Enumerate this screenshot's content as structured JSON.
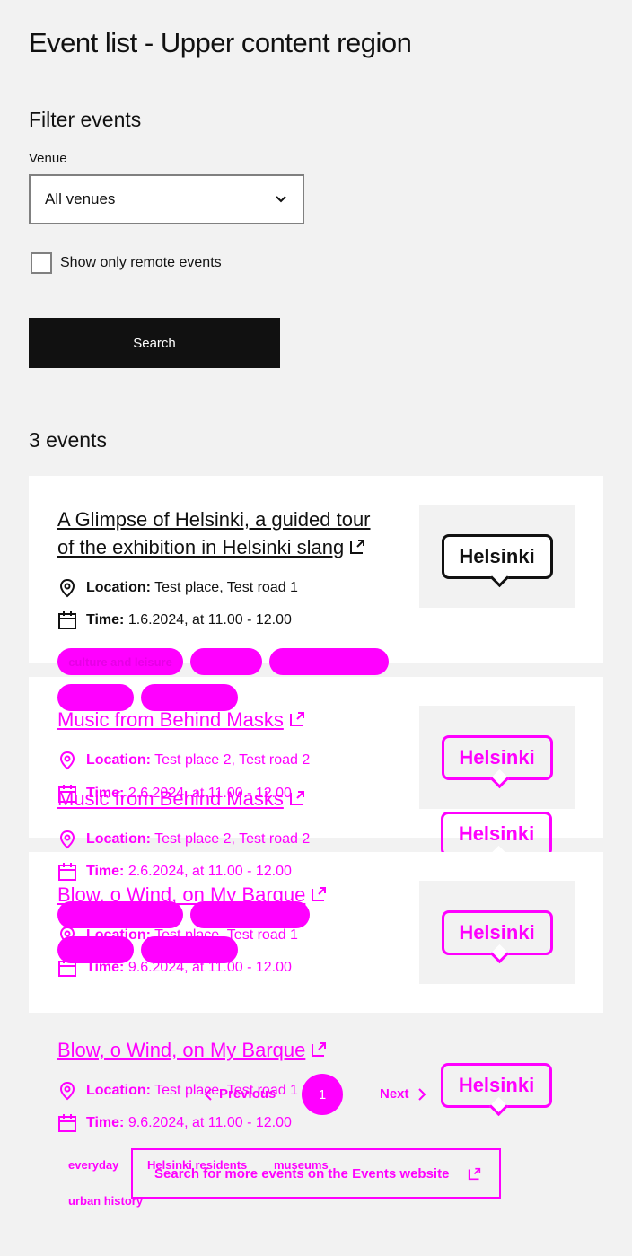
{
  "page": {
    "title": "Event list - Upper content region"
  },
  "filter": {
    "heading": "Filter events",
    "venue_label": "Venue",
    "venue_value": "All venues",
    "remote_label": "Show only remote events",
    "search_label": "Search"
  },
  "results": {
    "count_label": "3 events"
  },
  "labels": {
    "location": "Location:",
    "time": "Time:"
  },
  "events": [
    {
      "title_line1": "A Glimpse of Helsinki, a guided tour",
      "title_line2": "of the exhibition in Helsinki slang",
      "location": "Test place, Test road 1",
      "time": "1.6.2024, at 11.00 - 12.00",
      "tags": [
        "culture and leisure",
        "everyday",
        "Helsinki residents"
      ],
      "logo": "Helsinki"
    },
    {
      "title": "Music from Behind Masks",
      "location": "Test place 2, Test road 2",
      "time": "2.6.2024, at 11.00 - 12.00",
      "logo": "Helsinki"
    },
    {
      "title": "Blow, o Wind, on My Barque",
      "location": "Test place, Test road 1",
      "time": "9.6.2024, at 11.00 - 12.00",
      "tags": [
        "everyday",
        "Helsinki residents",
        "museums",
        "urban history"
      ],
      "logo": "Helsinki"
    }
  ],
  "pagination": {
    "previous": "Previous",
    "current": "1",
    "next": "Next"
  },
  "more_link": "Search for more events on the Events website",
  "colors": {
    "accent": "#ff00ff",
    "button": "#111111",
    "background": "#f2f2f2"
  }
}
